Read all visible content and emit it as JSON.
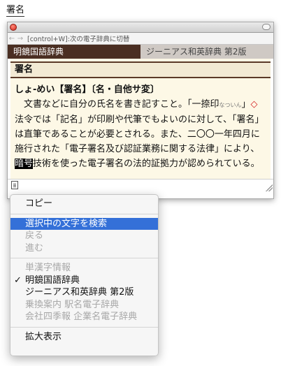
{
  "selected_word": "署名",
  "panel": {
    "nav_hint": "[control+W]:次の電子辞典に切替",
    "nav_back": "←",
    "nav_forward": "→",
    "tabs": [
      {
        "label": "明鏡国語辞典",
        "active": true
      },
      {
        "label": "ジーニアス和英辞典 第2版",
        "active": false
      }
    ],
    "headword": "署名",
    "entry": {
      "head": "しょ‐めい【署名】〔名・自他サ変〕",
      "body_1": "文書などに自分の氏名を書き記すこと。「一捺印",
      "body_small": "なついん",
      "body_2": "」",
      "diamond": "◇",
      "body_3": "法令では「記名」が印刷や代筆でもよいのに対して、「署名」は直筆であることが必要とされる。また、二〇〇一年四月に施行された「電子署名及び認証業務に関する法律」により、",
      "highlight": "暗号",
      "body_4": "技術を使った電子署名の法的証拠力が認められている。"
    }
  },
  "context_menu": {
    "copy": "コピー",
    "search_selected": "選択中の文字を検索",
    "back": "戻る",
    "forward": "進む",
    "kanji_info": "単漢字情報",
    "check_mark": "✓",
    "dict_meikyo": "明鏡国語辞典",
    "dict_genius": "ジーニアス和英辞典 第2版",
    "dict_norikae": "乗換案内 駅名電子辞典",
    "dict_shikiho": "会社四季報 企業名電子辞典",
    "zoom": "拡大表示"
  }
}
